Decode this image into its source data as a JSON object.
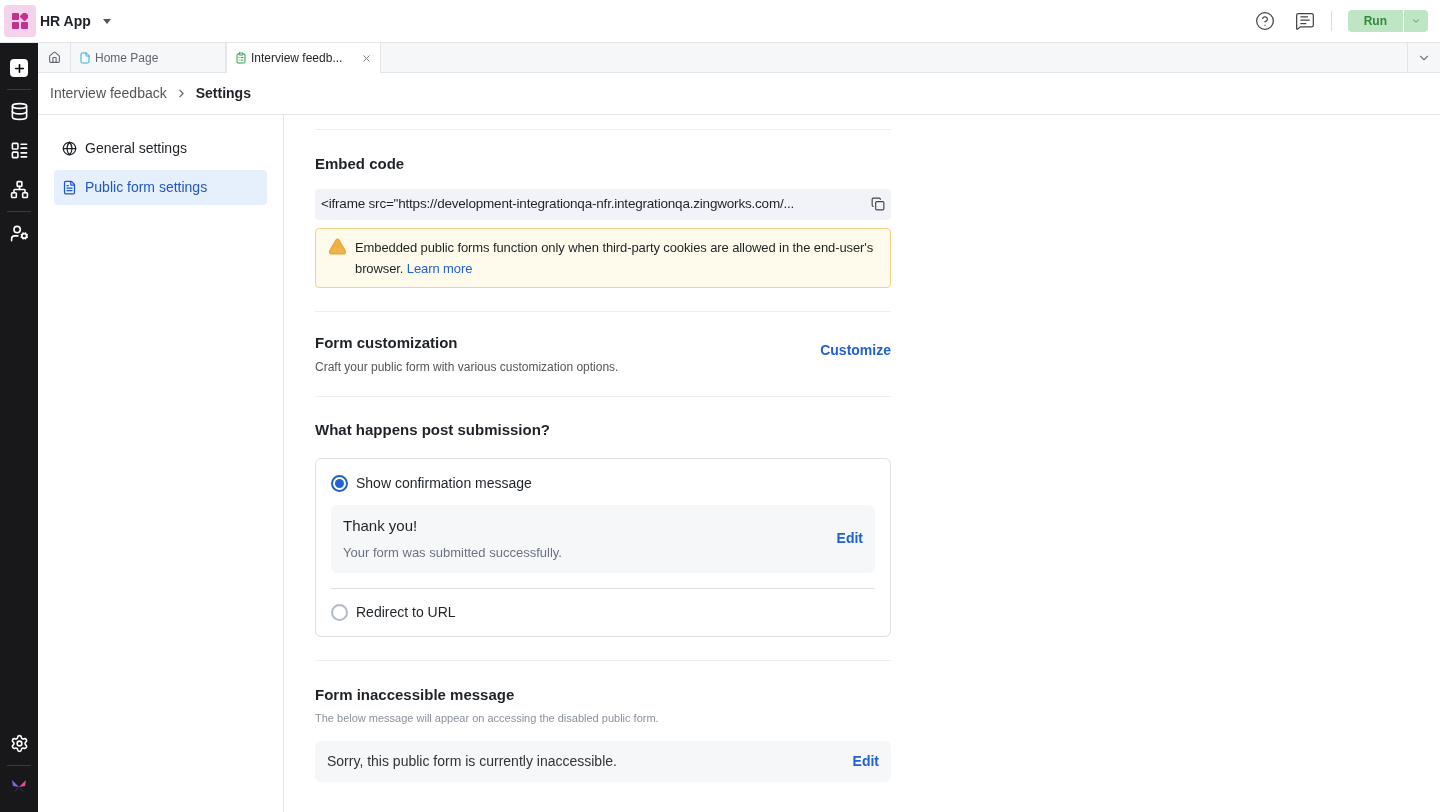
{
  "app": {
    "name": "HR App",
    "run_label": "Run"
  },
  "tabs": [
    {
      "label": "Home Page",
      "kind": "page",
      "selected": false,
      "closable": false
    },
    {
      "label": "Interview feedb...",
      "kind": "form",
      "selected": true,
      "closable": true
    }
  ],
  "breadcrumb": [
    "Interview feedback",
    "Settings"
  ],
  "settings_nav": [
    {
      "label": "General settings",
      "kind": "globe",
      "selected": false
    },
    {
      "label": "Public form settings",
      "kind": "form",
      "selected": true
    }
  ],
  "embed_code": {
    "title": "Embed code",
    "code": "<iframe src=\"https://development-integrationqa-nfr.integrationqa.zingworks.com/...",
    "warning": "Embedded public forms function only when third-party cookies are allowed in the end-user's browser.",
    "warning_link": "Learn more"
  },
  "customization": {
    "title": "Form customization",
    "description": "Craft your public form with various customization options.",
    "action": "Customize"
  },
  "post_submission": {
    "title": "What happens post submission?",
    "options": [
      {
        "label": "Show confirmation message",
        "selected": true
      },
      {
        "label": "Redirect to URL",
        "selected": false
      }
    ],
    "confirmation": {
      "title": "Thank you!",
      "message": "Your form was submitted successfully.",
      "action": "Edit"
    }
  },
  "inaccessible": {
    "title": "Form inaccessible message",
    "description": "The below message will appear on accessing the disabled public form.",
    "message": "Sorry, this public form is currently inaccessible.",
    "action": "Edit"
  }
}
